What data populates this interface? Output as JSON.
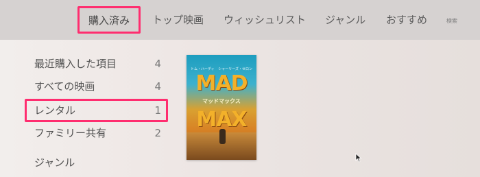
{
  "nav": {
    "items": [
      {
        "label": "購入済み"
      },
      {
        "label": "トップ映画"
      },
      {
        "label": "ウィッシュリスト"
      },
      {
        "label": "ジャンル"
      },
      {
        "label": "おすすめ"
      }
    ],
    "search": "検索"
  },
  "sidebar": {
    "items": [
      {
        "label": "最近購入した項目",
        "count": "4"
      },
      {
        "label": "すべての映画",
        "count": "4"
      },
      {
        "label": "レンタル",
        "count": "1"
      },
      {
        "label": "ファミリー共有",
        "count": "2"
      },
      {
        "label": "ジャンル",
        "count": ""
      }
    ]
  },
  "poster": {
    "actor_left": "トム・ハーディ",
    "actor_right": "シャーリーズ・セロン",
    "title_line1": "MAD",
    "title_line2": "MAX",
    "subtitle": "マッドマックス"
  },
  "colors": {
    "focus": "#ff2d6f",
    "nav_bar": "#d6d2d1"
  }
}
